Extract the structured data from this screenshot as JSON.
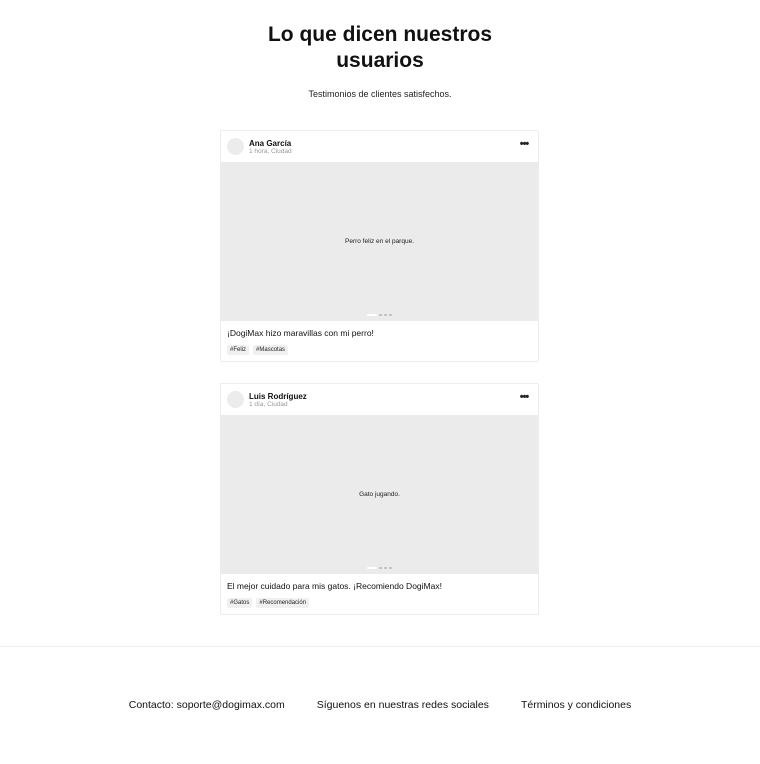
{
  "header": {
    "title": "Lo que dicen nuestros usuarios",
    "subtitle": "Testimonios de clientes satisfechos."
  },
  "posts": [
    {
      "user": "Ana García",
      "meta": "1 hora, Ciudad",
      "more": "•••",
      "image_caption": "Perro feliz en el parque.",
      "text": "¡DogiMax hizo maravillas con mi perro!",
      "tags": [
        "#Feliz",
        "#Mascotas"
      ]
    },
    {
      "user": "Luis Rodríguez",
      "meta": "1 día, Ciudad",
      "more": "•••",
      "image_caption": "Gato jugando.",
      "text": "El mejor cuidado para mis gatos. ¡Recomiendo DogiMax!",
      "tags": [
        "#Gatos",
        "#Recomendación"
      ]
    }
  ],
  "footer": {
    "contact": "Contacto: soporte@dogimax.com",
    "social": "Síguenos en nuestras redes sociales",
    "terms": "Términos y condiciones"
  }
}
